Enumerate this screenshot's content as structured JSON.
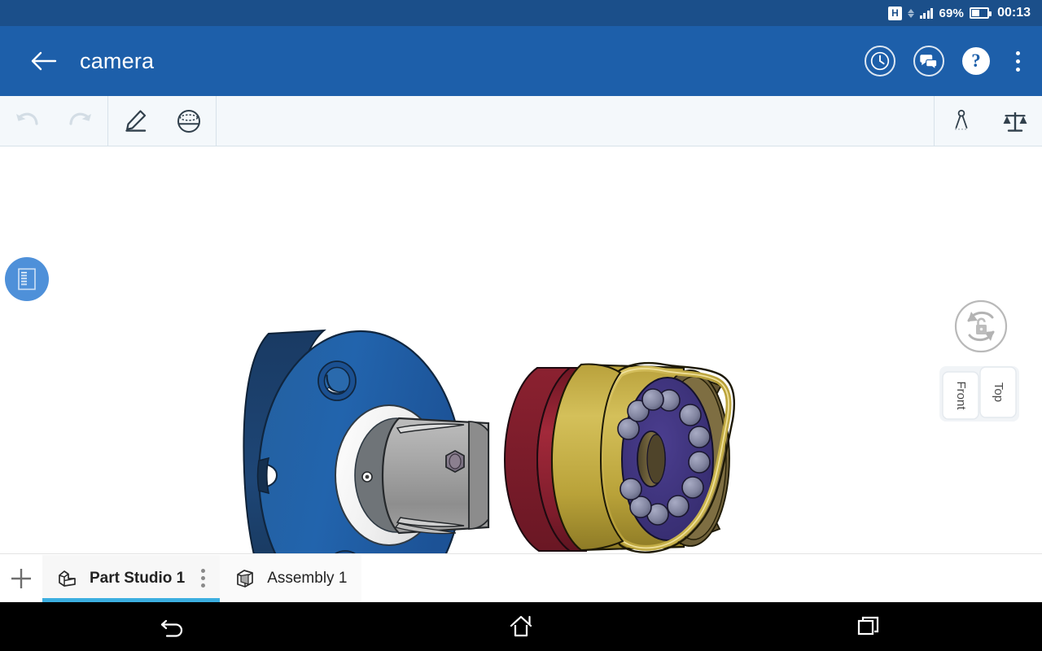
{
  "status_bar": {
    "network_badge": "H",
    "battery_percent": "69%",
    "time": "00:13",
    "icons": [
      "data-transfer-arrows-icon",
      "signal-bars-icon",
      "battery-icon"
    ]
  },
  "app_bar": {
    "back_label": "back-arrow",
    "title": "camera",
    "actions": [
      {
        "name": "version-history-button",
        "icon": "clock-icon"
      },
      {
        "name": "comments-button",
        "icon": "comment-bubbles-icon"
      },
      {
        "name": "help-button",
        "icon": "question-mark-icon",
        "glyph": "?"
      },
      {
        "name": "overflow-menu-button",
        "icon": "kebab-menu-icon"
      }
    ]
  },
  "toolbar": {
    "undo_label": "Undo",
    "redo_label": "Redo",
    "sketch_label": "Sketch",
    "revolve_label": "Revolve",
    "measure_label": "Measure",
    "mass_properties_label": "Mass properties",
    "undo_enabled": "false",
    "redo_enabled": "false"
  },
  "canvas": {
    "feature_list_button": "Feature list",
    "rotation_lock_button": "Rotation lock",
    "view_cube": {
      "front_label": "Front",
      "top_label": "Top"
    },
    "model": {
      "name": "camera",
      "colors": {
        "flange_face": "#1f5ba6",
        "flange_edge": "#1d3f6e",
        "white_ring": "#f2f2f2",
        "grey_cylinder": "#9a9a9a",
        "red_body": "#8e2030",
        "gold_body": "#c0a93f",
        "led_ring": "#3b3076",
        "led_sphere": "#7b7fa0"
      },
      "led_count": 12,
      "bolt_holes": 2
    }
  },
  "tabs": {
    "add_label": "+",
    "items": [
      {
        "label": "Part Studio 1",
        "icon": "part-studio-icon",
        "active": "true",
        "has_menu": "true"
      },
      {
        "label": "Assembly 1",
        "icon": "assembly-cube-icon",
        "active": "false",
        "has_menu": "false"
      }
    ]
  },
  "nav_bar": {
    "back_label": "Back",
    "home_label": "Home",
    "recents_label": "Recent apps"
  },
  "theme": {
    "status_bar_bg": "#1b4f8a",
    "app_bar_bg": "#1d5faa",
    "toolbar_bg": "#f4f8fb",
    "accent": "#3caee0",
    "fab_bg": "#4e90d9"
  }
}
